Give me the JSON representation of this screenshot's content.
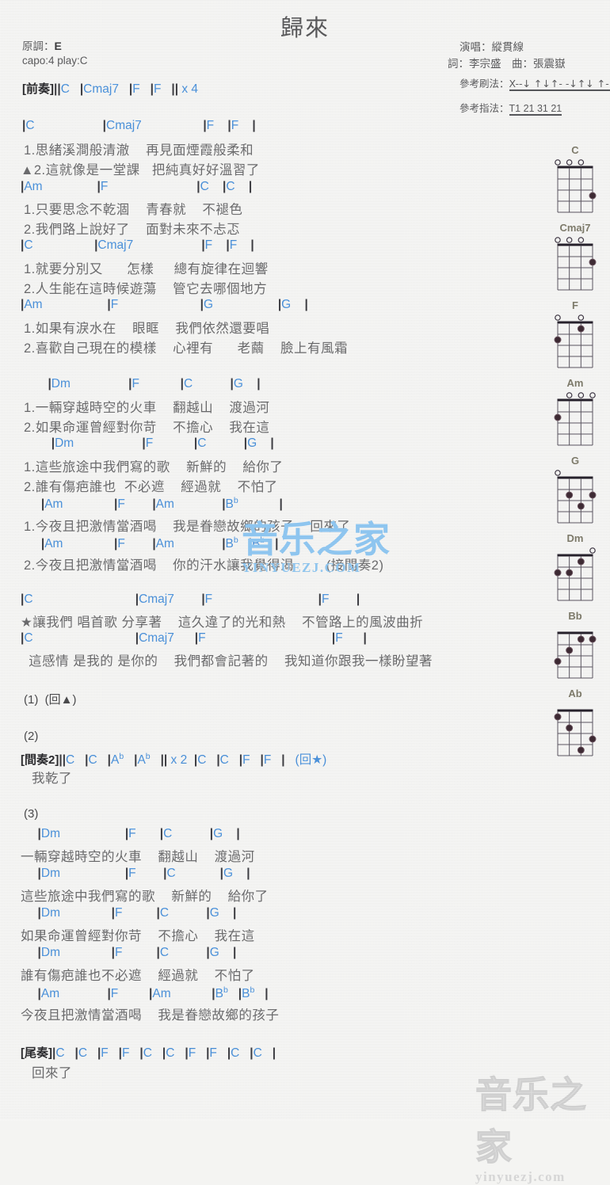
{
  "header": {
    "title": "歸來",
    "key_label": "原調：",
    "key_value": "E",
    "capo": "capo:4 play:C",
    "singer": "演唱：縱貫線",
    "credits": "詞：李宗盛　曲：張震嶽",
    "strum_label": "參考刷法：",
    "strum_pattern": "X--↓ ↑↓↑- -↓↑↓ ↑-↑↓",
    "pick_label": "參考指法：",
    "pick_pattern": "T1 21 31 21"
  },
  "watermarks": {
    "center_hanzi": "音乐之家",
    "center_latin": "YINYUEZJ.COM",
    "bottom_hanzi": "音乐之家",
    "bottom_latin": "yinyuezj.com"
  },
  "sections": {
    "intro_tag": "[前奏]",
    "intro_chords": "||C   |Cmaj7   |F   |F   || x 4",
    "interlude2_tag": "[間奏2]",
    "interlude2_chords": "||C   |C   |Ab   |Ab   || x 2  |C   |C   |F   |F   |   (回★)",
    "interlude2_lyric": "我乾了",
    "outro_tag": "[尾奏]",
    "outro_chords": "|C   |C   |F   |F   |C   |C   |F   |F   |C   |C   |",
    "outro_lyric": "回來了",
    "repeat_1": "(1)  (回▲)",
    "repeat_2": "(2)",
    "repeat_3": "(3)"
  },
  "verse1": [
    {
      "chords": "|C                    |Cmaj7                  |F    |F    |",
      "lyric_a": "1.思緒溪澗般清澈    再見面煙霞般柔和",
      "lyric_b": "▲2.這就像是一堂課   把純真好好溫習了"
    },
    {
      "chords": "|Am                |F                          |C    |C    |",
      "lyric_a": "1.只要思念不乾涸    青春就    不褪色",
      "lyric_b": "2.我們路上說好了    面對未來不忐忑"
    },
    {
      "chords": "|C                  |Cmaj7                    |F    |F    |",
      "lyric_a": "1.就要分別又      怎樣     總有旋律在迴響",
      "lyric_b": "2.人生能在這時候遊蕩    管它去哪個地方"
    },
    {
      "chords": "|Am                   |F                        |G                   |G    |",
      "lyric_a": "1.如果有淚水在    眼眶    我們依然還要唱",
      "lyric_b": "2.喜歡自己現在的模樣    心裡有      老繭    臉上有風霜"
    }
  ],
  "chorus1": [
    {
      "chords": "        |Dm                 |F            |C           |G    |",
      "lyric_a": "1.一輛穿越時空的火車    翻越山    渡過河",
      "lyric_b": "2.如果命運曾經對你苛    不擔心    我在這"
    },
    {
      "chords": "         |Dm                    |F            |C           |G    |",
      "lyric_a": "1.這些旅途中我們寫的歌    新鮮的    給你了",
      "lyric_b": "2.誰有傷疤誰也  不必遮    經過就    不怕了"
    }
  ],
  "chorus1_am": [
    {
      "chords": "      |Am               |F        |Am              |Bb            |",
      "lyric": "1.今夜且把激情當酒喝    我是眷戀故鄉的孩子    回來了"
    },
    {
      "chords": "      |Am               |F        |Am              |Bb   |Bb   |",
      "lyric": "2.今夜且把激情當酒喝    你的汗水讓我覺得渴        (接間奏2)"
    }
  ],
  "bridge": [
    {
      "chords": "|C                              |Cmaj7        |F                               |F        |",
      "lyric": "★讓我們 唱首歌 分享著    這久違了的光和熱    不管路上的風波曲折"
    },
    {
      "chords": "|C                              |Cmaj7      |F                                     |F      |",
      "lyric": "  這感情 是我的 是你的    我們都會記著的    我知道你跟我一樣盼望著"
    }
  ],
  "section3": [
    {
      "chords": "     |Dm                   |F       |C           |G    |",
      "lyric": "一輛穿越時空的火車    翻越山    渡過河"
    },
    {
      "chords": "     |Dm                   |F        |C             |G    |",
      "lyric": "這些旅途中我們寫的歌    新鮮的    給你了"
    },
    {
      "chords": "     |Dm               |F          |C           |G    |",
      "lyric": "如果命運曾經對你苛    不擔心    我在這"
    },
    {
      "chords": "     |Dm               |F          |C           |G    |",
      "lyric": "誰有傷疤誰也不必遮    經過就    不怕了"
    },
    {
      "chords": "     |Am              |F         |Am            |Bb   |Bb   |",
      "lyric": "今夜且把激情當酒喝    我是眷戀故鄉的孩子"
    }
  ],
  "chord_diagrams": [
    {
      "name": "C",
      "open": [
        1,
        1,
        1,
        0
      ],
      "dots": [
        [
          4,
          3
        ]
      ]
    },
    {
      "name": "Cmaj7",
      "open": [
        1,
        1,
        1,
        0
      ],
      "dots": [
        [
          4,
          2
        ]
      ]
    },
    {
      "name": "F",
      "open": [
        1,
        0,
        1,
        0
      ],
      "dots": [
        [
          1,
          2
        ],
        [
          3,
          1
        ]
      ]
    },
    {
      "name": "Am",
      "open": [
        0,
        1,
        1,
        1
      ],
      "dots": [
        [
          1,
          2
        ]
      ]
    },
    {
      "name": "G",
      "open": [
        1,
        0,
        0,
        0
      ],
      "dots": [
        [
          2,
          2
        ],
        [
          3,
          3
        ],
        [
          4,
          2
        ]
      ]
    },
    {
      "name": "Dm",
      "open": [
        0,
        0,
        0,
        1
      ],
      "dots": [
        [
          1,
          2
        ],
        [
          2,
          2
        ],
        [
          3,
          1
        ]
      ]
    },
    {
      "name": "Bb",
      "open": [
        0,
        0,
        0,
        0
      ],
      "dots": [
        [
          1,
          3
        ],
        [
          2,
          2
        ],
        [
          3,
          1
        ],
        [
          4,
          1
        ]
      ]
    },
    {
      "name": "Ab",
      "open": [
        0,
        0,
        0,
        0
      ],
      "dots": [
        [
          1,
          1
        ],
        [
          2,
          2
        ],
        [
          3,
          4
        ],
        [
          4,
          3
        ]
      ]
    }
  ]
}
